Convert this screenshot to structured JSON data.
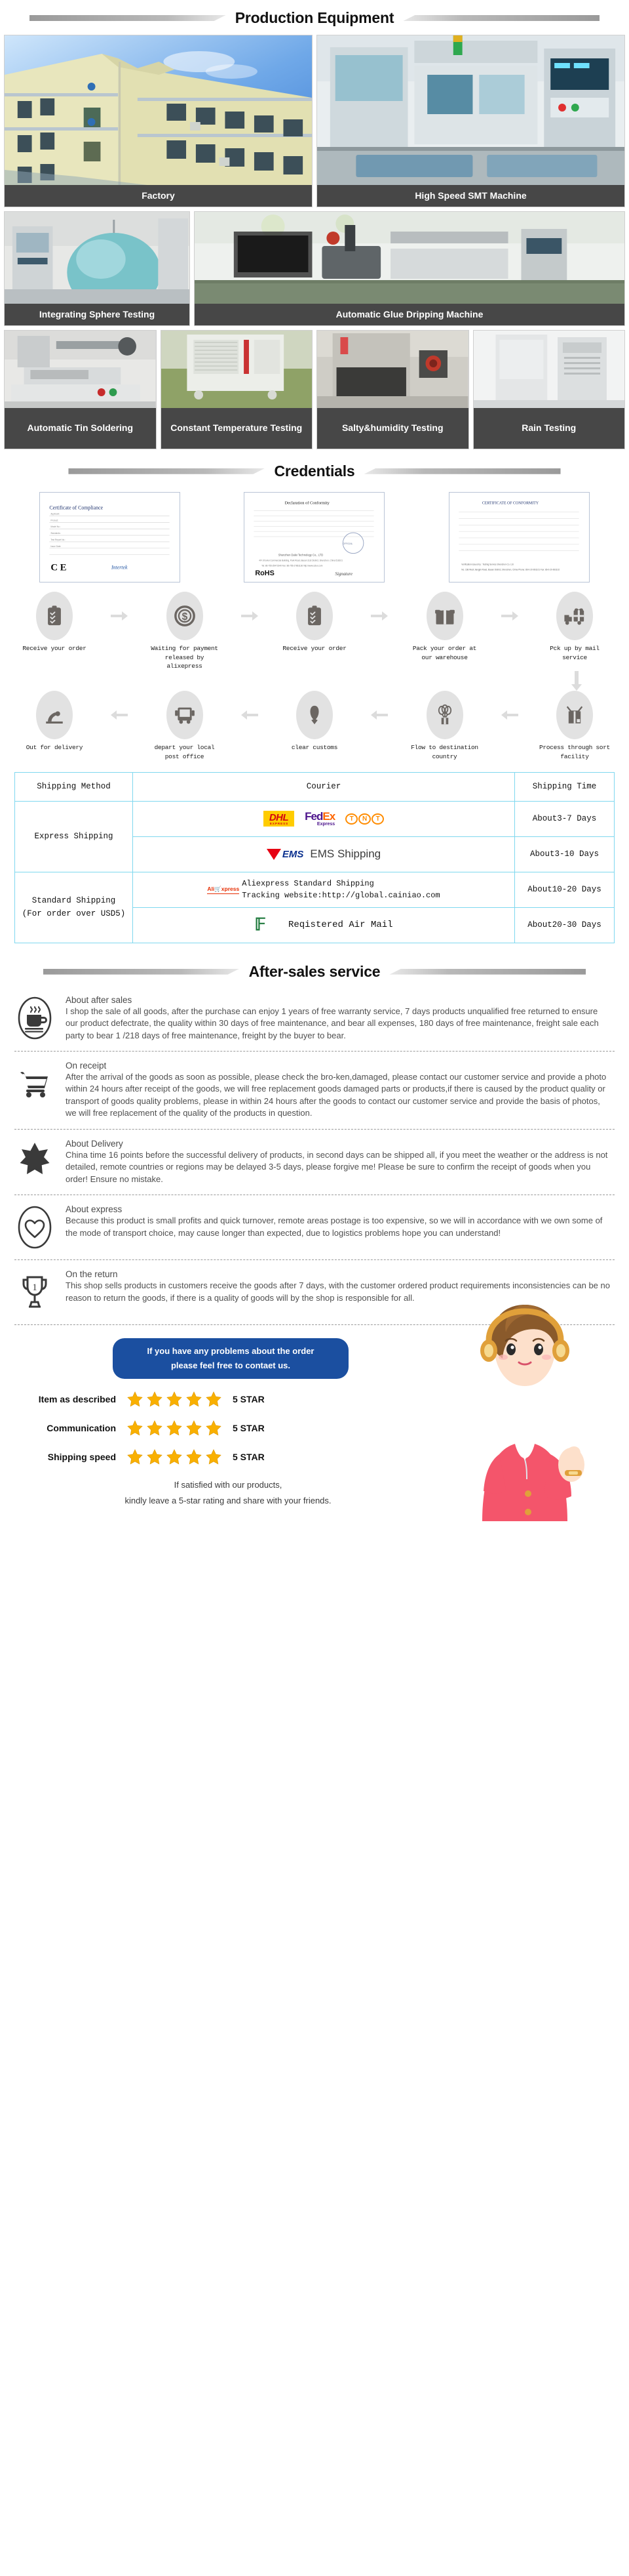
{
  "sections": {
    "production": {
      "title": "Production Equipment"
    },
    "credentials": {
      "title": "Credentials"
    },
    "aftersales": {
      "title": "After-sales service"
    }
  },
  "equipment": {
    "row1": [
      {
        "caption": "Factory",
        "icon": "factory-building-photo"
      },
      {
        "caption": "High Speed SMT Machine",
        "icon": "smt-machine-photo"
      }
    ],
    "row2": [
      {
        "caption": "Integrating Sphere Testing",
        "icon": "integrating-sphere-photo"
      },
      {
        "caption": "Automatic Glue Dripping Machine",
        "icon": "glue-dripping-machine-photo"
      }
    ],
    "row3": [
      {
        "caption": "Automatic Tin Soldering",
        "icon": "tin-soldering-photo"
      },
      {
        "caption": "Constant Temperature Testing",
        "icon": "constant-temperature-photo"
      },
      {
        "caption": "Salty&humidity Testing",
        "icon": "salty-humidity-photo"
      },
      {
        "caption": "Rain Testing",
        "icon": "rain-testing-photo"
      }
    ]
  },
  "certificates": [
    {
      "name": "Certificate of Compliance",
      "mark": "CE",
      "issuer": "Intertek"
    },
    {
      "name": "Declaration of Conformity",
      "mark": "RoHS",
      "issuer": "Shenzhen Dalei Technology Co., LTD"
    },
    {
      "name": "CERTIFICATE OF CONFORMITY",
      "mark": "",
      "issuer": "Testing Service Shenzhen Co. Ltd"
    }
  ],
  "flow": {
    "row1": [
      {
        "label": "Receive\nyour order",
        "icon": "clipboard-checklist-icon"
      },
      {
        "label": "Waiting for payment\nreleased by alixepress",
        "icon": "dollar-coin-icon"
      },
      {
        "label": "Receive\nyour order",
        "icon": "clipboard-checklist-icon"
      },
      {
        "label": "Pack your order\nat our warehouse",
        "icon": "gift-box-icon"
      },
      {
        "label": "Pck up by\nmail service",
        "icon": "delivery-truck-gift-icon"
      }
    ],
    "row2": [
      {
        "label": "Out for\ndelivery",
        "icon": "doorstep-delivery-icon"
      },
      {
        "label": "depart your\nlocal post office",
        "icon": "post-truck-icon"
      },
      {
        "label": "clear customs",
        "icon": "customs-officer-icon"
      },
      {
        "label": "Flow to\ndestination country",
        "icon": "balloon-parcel-icon"
      },
      {
        "label": "Process through\nsort facility",
        "icon": "sorting-parcel-icon"
      }
    ]
  },
  "shipping_table": {
    "headers": [
      "Shipping Method",
      "Courier",
      "Shipping Time"
    ],
    "groups": [
      {
        "method": "Express Shipping",
        "rows": [
          {
            "courier_type": "express-logos",
            "couriers": [
              "DHL",
              "FedEx",
              "TNT"
            ],
            "fedex_sub": "Express",
            "dhl_sub": "EXPRESS",
            "time": "About3-7 Days"
          },
          {
            "courier_type": "ems",
            "logo_text": "EMS",
            "courier_name": "EMS Shipping",
            "time": "About3-10 Days"
          }
        ]
      },
      {
        "method": "Standard Shipping\n(For order over USD5)",
        "method_line1": "Standard Shipping",
        "method_line2": "(For order over USD5)",
        "rows": [
          {
            "courier_type": "aliexpress",
            "logo_text": "AliExpress",
            "courier_name": "Aliexpress Standard Shipping",
            "tracking": "Tracking website:http://global.cainiao.com",
            "time": "About10-20 Days"
          },
          {
            "courier_type": "airmail",
            "courier_name": "Reqistered Air Mail",
            "time": "About20-30 Days"
          }
        ]
      }
    ]
  },
  "aftersales_blocks": [
    {
      "icon": "coffee-cup-icon",
      "title": "About after sales",
      "body": " I shop the sale of all goods, after the purchase can enjoy 1 years of free warranty service, 7 days products unqualified free returned to ensure our product defectrate, the quality within 30 days of free maintenance, and bear all expenses, 180 days of free maintenance, freight sale each party to bear 1 /218 days of free maintenance, freight by the buyer to bear."
    },
    {
      "icon": "shopping-cart-icon",
      "title": "On receipt",
      "body": "After the arrival of the goods as soon as possible, please check the bro-ken,damaged, please contact our customer service and provide a photo within 24 hours after receipt of the goods, we will free replacement goods damaged parts or products,if there is caused by the product quality or transport of goods quality problems, please in within 24 hours after the goods to contact our customer service and provide the basis of photos, we will free replacement of the quality of the products in question."
    },
    {
      "icon": "star-badge-icon",
      "title": "About Delivery",
      "body": "China time 16 points before the successful delivery of products, in second days can be shipped all, if you meet the weather or the address is not detailed, remote countries or regions may be delayed 3-5 days, please forgive me! Please be sure to confirm the receipt of goods when you order! Ensure no mistake."
    },
    {
      "icon": "heart-icon",
      "title": "About express",
      "body": "Because this product is small profits and quick turnover, remote areas postage is too expensive, so we will in accordance with we own some of the mode of transport choice, may cause longer than expected, due to logistics problems hope you can understand!"
    },
    {
      "icon": "trophy-icon",
      "title": "On the return",
      "body": "This shop sells products in customers receive the goods after 7 days, with the customer ordered product requirements inconsistencies can be no reason to return the goods, if there is a quality of goods will by the shop is responsible for all."
    }
  ],
  "footer": {
    "contact_banner_line1": "If you have any problems about the order",
    "contact_banner_line2": "please feel free to contaet us.",
    "ratings": [
      {
        "label": "Item as described",
        "stars": 5,
        "value": "5 STAR"
      },
      {
        "label": "Communication",
        "stars": 5,
        "value": "5 STAR"
      },
      {
        "label": "Shipping speed",
        "stars": 5,
        "value": "5 STAR"
      }
    ],
    "note_line1": "If satisfied with our products,",
    "note_line2": "kindly leave a 5-star rating and share with your friends.",
    "mascot": "customer-service-girl-illustration"
  },
  "colors": {
    "caption_bg": "#474747",
    "table_border": "#7fd8ef",
    "method_label": "#f5c143",
    "banner_blue": "#1b4fa0",
    "star_gold": "#f9b000"
  }
}
